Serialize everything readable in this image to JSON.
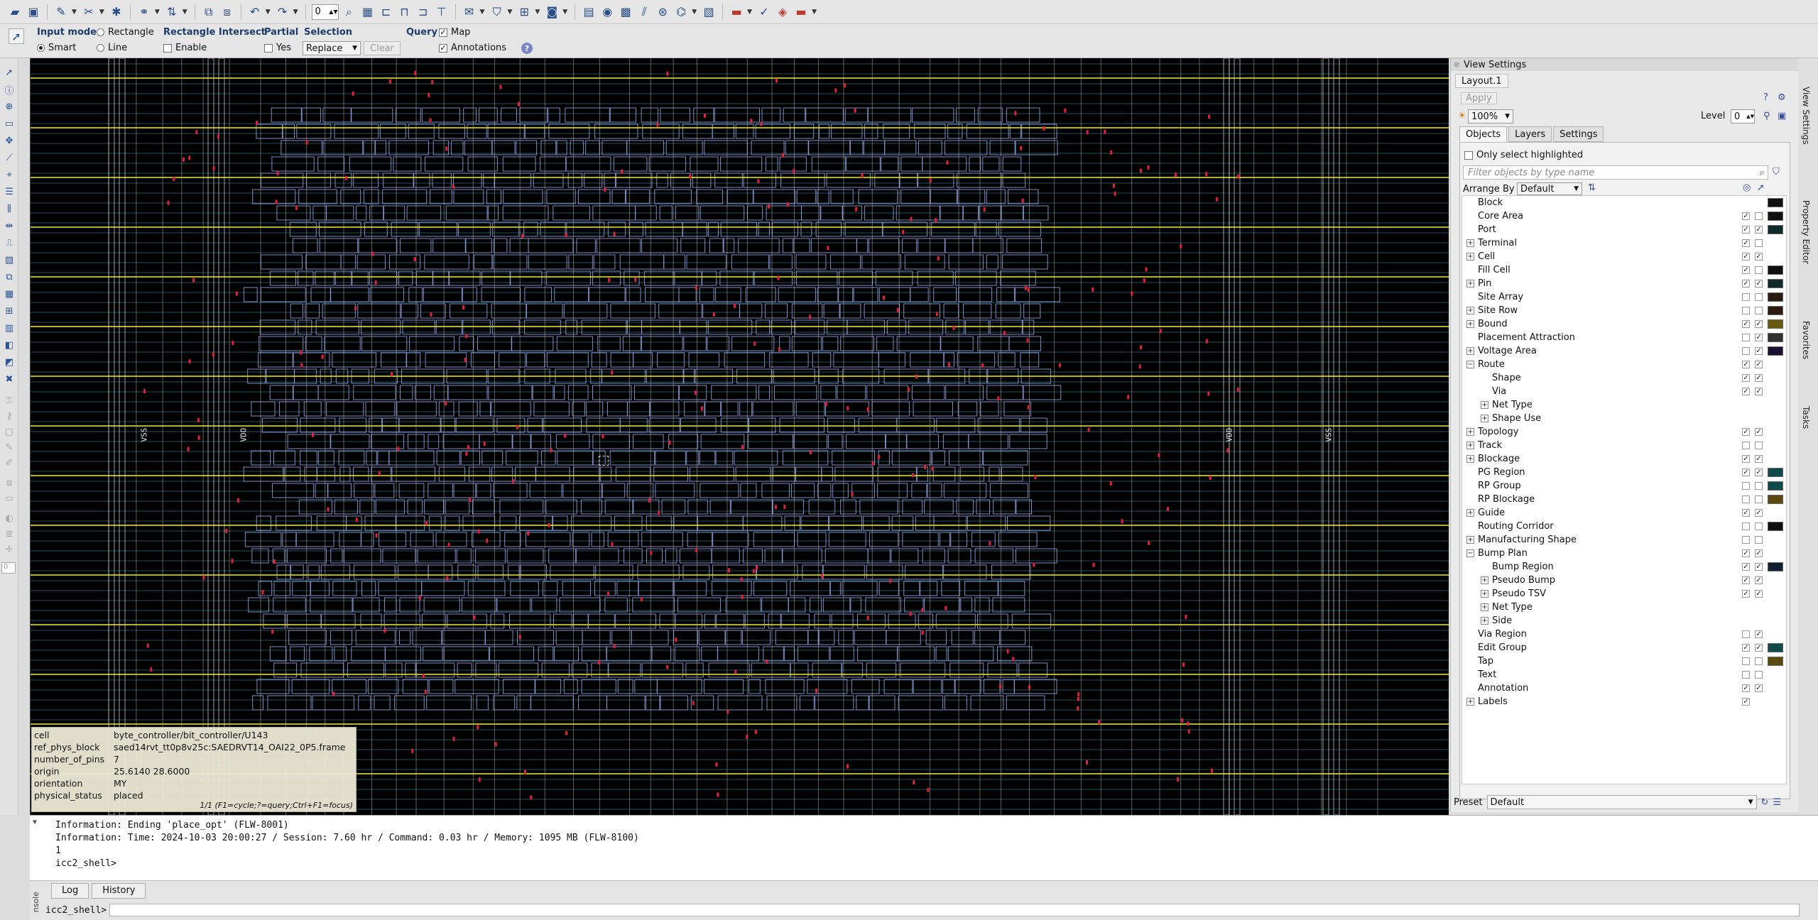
{
  "toolbar1": {
    "level_value": "0"
  },
  "toolbar2": {
    "input_mode": {
      "label": "Input mode",
      "options": [
        "Smart",
        "Rectangle",
        "Line"
      ],
      "selected": "Smart"
    },
    "rect_intersect": {
      "label": "Rectangle Intersect",
      "enable_label": "Enable",
      "enabled": false
    },
    "partial": {
      "label": "Partial",
      "yes_label": "Yes",
      "checked": false
    },
    "selection": {
      "label": "Selection",
      "value": "Replace",
      "clear_label": "Clear"
    },
    "query": {
      "label": "Query",
      "map_label": "Map",
      "map_checked": true,
      "annotations_label": "Annotations",
      "annotations_checked": true
    },
    "help_icon": "help-icon"
  },
  "left_tools": {
    "spin_value": "0"
  },
  "canvas": {
    "rail_labels": [
      "VSS",
      "VDD",
      "VDD",
      "VSS"
    ],
    "colors": {
      "background": "#000000",
      "rail": "#d8d800",
      "track": "#33b9d8",
      "cell": "#8e9bd8",
      "pin": "#e0203c"
    }
  },
  "info_panel": {
    "rows": [
      {
        "key": "cell",
        "value": "byte_controller/bit_controller/U143"
      },
      {
        "key": "ref_phys_block",
        "value": "saed14rvt_tt0p8v25c:SAEDRVT14_OAI22_0P5.frame"
      },
      {
        "key": "number_of_pins",
        "value": "7"
      },
      {
        "key": "origin",
        "value": "25.6140 28.6000"
      },
      {
        "key": "orientation",
        "value": "MY"
      },
      {
        "key": "physical_status",
        "value": "placed"
      }
    ],
    "footer": "1/1 (F1=cycle;?=query;Ctrl+F1=focus)"
  },
  "view_settings": {
    "title": "View Settings",
    "tab": "Layout.1",
    "apply_label": "Apply",
    "zoom_value": "100%",
    "level_label": "Level",
    "level_value": "0",
    "subtabs": [
      "Objects",
      "Layers",
      "Settings"
    ],
    "active_subtab": "Objects",
    "only_select_highlighted": "Only select highlighted",
    "filter_placeholder": "Filter objects by type name",
    "arrange_by_label": "Arrange By",
    "arrange_by_value": "Default",
    "preset_label": "Preset",
    "preset_value": "Default",
    "tree": [
      {
        "label": "Block",
        "indent": 0,
        "exp": false,
        "vis": null,
        "sel": null,
        "swatch": "#101010"
      },
      {
        "label": "Core Area",
        "indent": 0,
        "exp": false,
        "vis": true,
        "sel": false,
        "swatch": "#101010"
      },
      {
        "label": "Port",
        "indent": 0,
        "exp": false,
        "vis": true,
        "sel": true,
        "swatch": "#0f2a2a"
      },
      {
        "label": "Terminal",
        "indent": 0,
        "exp": true,
        "vis": true,
        "sel": false,
        "swatch": null
      },
      {
        "label": "Cell",
        "indent": 0,
        "exp": true,
        "vis": true,
        "sel": true,
        "swatch": null
      },
      {
        "label": "Fill Cell",
        "indent": 0,
        "exp": false,
        "vis": true,
        "sel": false,
        "swatch": "#101010"
      },
      {
        "label": "Pin",
        "indent": 0,
        "exp": true,
        "vis": true,
        "sel": true,
        "swatch": "#0f2a2a"
      },
      {
        "label": "Site Array",
        "indent": 0,
        "exp": false,
        "vis": false,
        "sel": false,
        "swatch": "#2a1a10"
      },
      {
        "label": "Site Row",
        "indent": 0,
        "exp": true,
        "vis": false,
        "sel": false,
        "swatch": "#2a1a10"
      },
      {
        "label": "Bound",
        "indent": 0,
        "exp": true,
        "vis": true,
        "sel": true,
        "swatch": "#6a5a10"
      },
      {
        "label": "Placement Attraction",
        "indent": 0,
        "exp": false,
        "vis": false,
        "sel": true,
        "swatch": "#303030"
      },
      {
        "label": "Voltage Area",
        "indent": 0,
        "exp": true,
        "vis": false,
        "sel": true,
        "swatch": "#1a1030"
      },
      {
        "label": "Route",
        "indent": 0,
        "exp": "open",
        "vis": true,
        "sel": true,
        "swatch": null
      },
      {
        "label": "Shape",
        "indent": 1,
        "exp": false,
        "vis": true,
        "sel": true,
        "swatch": null
      },
      {
        "label": "Via",
        "indent": 1,
        "exp": false,
        "vis": true,
        "sel": true,
        "swatch": null
      },
      {
        "label": "Net Type",
        "indent": 1,
        "exp": true,
        "vis": null,
        "sel": null,
        "swatch": null
      },
      {
        "label": "Shape Use",
        "indent": 1,
        "exp": true,
        "vis": null,
        "sel": null,
        "swatch": null
      },
      {
        "label": "Topology",
        "indent": 0,
        "exp": true,
        "vis": true,
        "sel": true,
        "swatch": null
      },
      {
        "label": "Track",
        "indent": 0,
        "exp": true,
        "vis": false,
        "sel": false,
        "swatch": null
      },
      {
        "label": "Blockage",
        "indent": 0,
        "exp": true,
        "vis": true,
        "sel": true,
        "swatch": null
      },
      {
        "label": "PG Region",
        "indent": 0,
        "exp": false,
        "vis": true,
        "sel": true,
        "swatch": "#0f4a4a"
      },
      {
        "label": "RP Group",
        "indent": 0,
        "exp": false,
        "vis": false,
        "sel": false,
        "swatch": "#0f4a4a"
      },
      {
        "label": "RP Blockage",
        "indent": 0,
        "exp": false,
        "vis": false,
        "sel": false,
        "swatch": "#5a4a10"
      },
      {
        "label": "Guide",
        "indent": 0,
        "exp": true,
        "vis": true,
        "sel": true,
        "swatch": null
      },
      {
        "label": "Routing Corridor",
        "indent": 0,
        "exp": false,
        "vis": false,
        "sel": false,
        "swatch": "#101010"
      },
      {
        "label": "Manufacturing Shape",
        "indent": 0,
        "exp": true,
        "vis": false,
        "sel": false,
        "swatch": null
      },
      {
        "label": "Bump Plan",
        "indent": 0,
        "exp": "open",
        "vis": true,
        "sel": true,
        "swatch": null
      },
      {
        "label": "Bump Region",
        "indent": 1,
        "exp": false,
        "vis": true,
        "sel": true,
        "swatch": "#102030"
      },
      {
        "label": "Pseudo Bump",
        "indent": 1,
        "exp": true,
        "vis": true,
        "sel": true,
        "swatch": null
      },
      {
        "label": "Pseudo TSV",
        "indent": 1,
        "exp": true,
        "vis": true,
        "sel": true,
        "swatch": null
      },
      {
        "label": "Net Type",
        "indent": 1,
        "exp": true,
        "vis": null,
        "sel": null,
        "swatch": null
      },
      {
        "label": "Side",
        "indent": 1,
        "exp": true,
        "vis": null,
        "sel": null,
        "swatch": null
      },
      {
        "label": "Via Region",
        "indent": 0,
        "exp": false,
        "vis": false,
        "sel": true,
        "swatch": null
      },
      {
        "label": "Edit Group",
        "indent": 0,
        "exp": false,
        "vis": true,
        "sel": true,
        "swatch": "#0f4a4a"
      },
      {
        "label": "Tap",
        "indent": 0,
        "exp": false,
        "vis": false,
        "sel": false,
        "swatch": "#5a4a10"
      },
      {
        "label": "Text",
        "indent": 0,
        "exp": false,
        "vis": false,
        "sel": false,
        "swatch": null
      },
      {
        "label": "Annotation",
        "indent": 0,
        "exp": false,
        "vis": true,
        "sel": true,
        "swatch": null
      },
      {
        "label": "Labels",
        "indent": 0,
        "exp": true,
        "vis": true,
        "sel": null,
        "swatch": null
      }
    ]
  },
  "side_tabs": [
    "View Settings",
    "Property Editor",
    "Favorites",
    "Tasks"
  ],
  "console": {
    "lines": [
      "Information: Ending 'place_opt' (FLW-8001)",
      "Information: Time: 2024-10-03 20:00:27 / Session: 7.60 hr / Command: 0.03 hr / Memory: 1095 MB (FLW-8100)",
      "1",
      "icc2_shell>"
    ],
    "tabs": [
      "Log",
      "History"
    ],
    "prompt": "icc2_shell>",
    "vertical_label": "nsole"
  }
}
